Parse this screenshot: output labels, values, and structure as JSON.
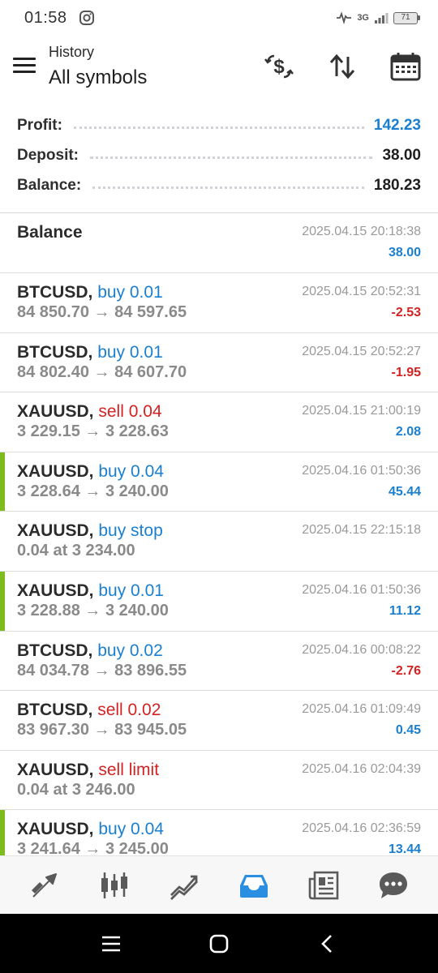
{
  "status_bar": {
    "time": "01:58",
    "network": "3G",
    "battery": "71"
  },
  "header": {
    "subtitle": "History",
    "title": "All symbols"
  },
  "summary": [
    {
      "label": "Profit:",
      "value": "142.23",
      "color": "#1a7fd0"
    },
    {
      "label": "Deposit:",
      "value": "38.00",
      "color": "#1e1e1e"
    },
    {
      "label": "Balance:",
      "value": "180.23",
      "color": "#1e1e1e"
    }
  ],
  "entries": [
    {
      "symbol": "Balance",
      "side": "",
      "side_type": "",
      "detail": "",
      "time": "2025.04.15 20:18:38",
      "profit": "38.00",
      "profit_type": "pos",
      "accent": false
    },
    {
      "symbol": "BTCUSD,",
      "side": "buy 0.01",
      "side_type": "buy",
      "detail": "84 850.70 → 84 597.65",
      "time": "2025.04.15 20:52:31",
      "profit": "-2.53",
      "profit_type": "neg",
      "accent": false
    },
    {
      "symbol": "BTCUSD,",
      "side": "buy 0.01",
      "side_type": "buy",
      "detail": "84 802.40 → 84 607.70",
      "time": "2025.04.15 20:52:27",
      "profit": "-1.95",
      "profit_type": "neg",
      "accent": false
    },
    {
      "symbol": "XAUUSD,",
      "side": "sell 0.04",
      "side_type": "sell",
      "detail": "3 229.15 → 3 228.63",
      "time": "2025.04.15 21:00:19",
      "profit": "2.08",
      "profit_type": "pos",
      "accent": false
    },
    {
      "symbol": "XAUUSD,",
      "side": "buy 0.04",
      "side_type": "buy",
      "detail": "3 228.64 → 3 240.00",
      "time": "2025.04.16 01:50:36",
      "profit": "45.44",
      "profit_type": "pos",
      "accent": true
    },
    {
      "symbol": "XAUUSD,",
      "side": "buy stop",
      "side_type": "buy",
      "detail": "0.04 at 3 234.00",
      "time": "2025.04.15 22:15:18",
      "profit": "",
      "profit_type": "pos",
      "accent": false
    },
    {
      "symbol": "XAUUSD,",
      "side": "buy 0.01",
      "side_type": "buy",
      "detail": "3 228.88 → 3 240.00",
      "time": "2025.04.16 01:50:36",
      "profit": "11.12",
      "profit_type": "pos",
      "accent": true
    },
    {
      "symbol": "BTCUSD,",
      "side": "buy 0.02",
      "side_type": "buy",
      "detail": "84 034.78 → 83 896.55",
      "time": "2025.04.16 00:08:22",
      "profit": "-2.76",
      "profit_type": "neg",
      "accent": false
    },
    {
      "symbol": "BTCUSD,",
      "side": "sell 0.02",
      "side_type": "sell",
      "detail": "83 967.30 → 83 945.05",
      "time": "2025.04.16 01:09:49",
      "profit": "0.45",
      "profit_type": "pos",
      "accent": false
    },
    {
      "symbol": "XAUUSD,",
      "side": "sell limit",
      "side_type": "sell",
      "detail": "0.04 at 3 246.00",
      "time": "2025.04.16 02:04:39",
      "profit": "",
      "profit_type": "pos",
      "accent": false
    },
    {
      "symbol": "XAUUSD,",
      "side": "buy 0.04",
      "side_type": "buy",
      "detail": "3 241.64 → 3 245.00",
      "time": "2025.04.16 02:36:59",
      "profit": "13.44",
      "profit_type": "pos",
      "accent": true
    }
  ],
  "tabs": [
    {
      "name": "tab-quotes",
      "icon": "quotes-arrows-icon",
      "active": false
    },
    {
      "name": "tab-chart",
      "icon": "candlestick-icon",
      "active": false
    },
    {
      "name": "tab-trade",
      "icon": "trend-lines-icon",
      "active": false
    },
    {
      "name": "tab-history",
      "icon": "inbox-icon",
      "active": true
    },
    {
      "name": "tab-news",
      "icon": "newspaper-icon",
      "active": false
    },
    {
      "name": "tab-messages",
      "icon": "chat-bubble-icon",
      "active": false
    }
  ],
  "colors": {
    "accent_green": "#7dbb1f",
    "buy_blue": "#1a7fd0",
    "sell_red": "#d42222",
    "active_tab": "#2a8fe0",
    "inactive_tab": "#5a5a5a"
  }
}
